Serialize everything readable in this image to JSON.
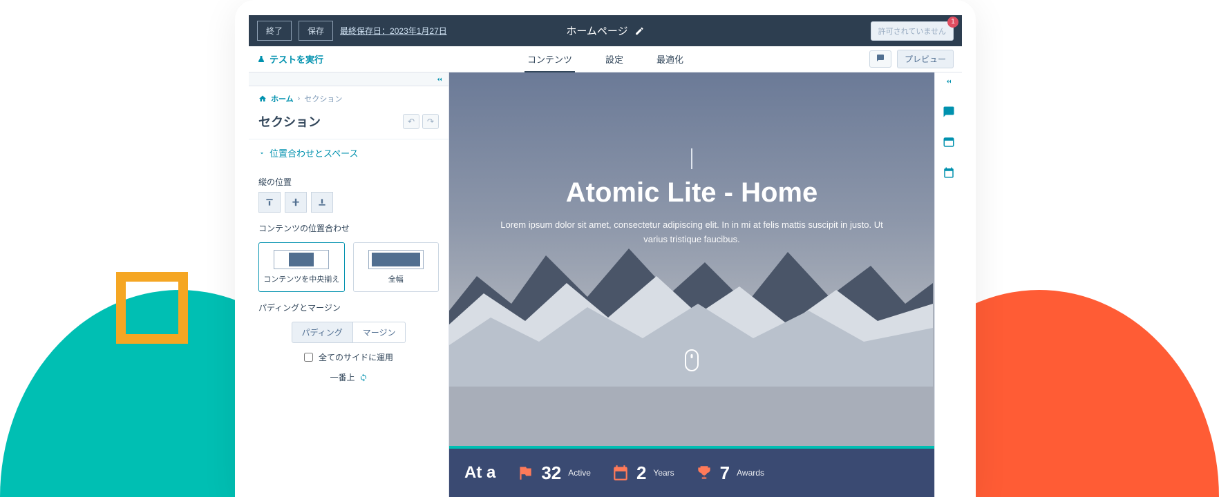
{
  "topbar": {
    "exit": "終了",
    "save": "保存",
    "last_saved_prefix": "最終保存日：",
    "last_saved_date": "2023年1月27日",
    "page_title": "ホームページ",
    "permit": "許可されていません",
    "badge": "1"
  },
  "subbar": {
    "run_test": "テストを実行",
    "tabs": {
      "content": "コンテンツ",
      "settings": "設定",
      "optimize": "最適化"
    },
    "preview": "プレビュー"
  },
  "breadcrumbs": {
    "home": "ホーム",
    "section": "セクション"
  },
  "panel": {
    "title": "セクション",
    "accordion1": "位置合わせとスペース",
    "vertical_pos": "縦の位置",
    "content_align": "コンテンツの位置合わせ",
    "center_content": "コンテンツを中央揃え",
    "full_width": "全幅",
    "padding_margin_label": "パディングとマージン",
    "padding": "パディング",
    "margin": "マージン",
    "apply_all": "全てのサイドに運用",
    "top_label": "一番上"
  },
  "hero": {
    "title": "Atomic Lite - Home",
    "subtitle": "Lorem ipsum dolor sit amet, consectetur adipiscing elit. In in mi at felis mattis suscipit in justo. Ut varius tristique faucibus."
  },
  "stats": {
    "heading": "At a",
    "items": [
      {
        "num": "32",
        "label": "Active"
      },
      {
        "num": "2",
        "label": "Years"
      },
      {
        "num": "7",
        "label": "Awards"
      }
    ]
  }
}
